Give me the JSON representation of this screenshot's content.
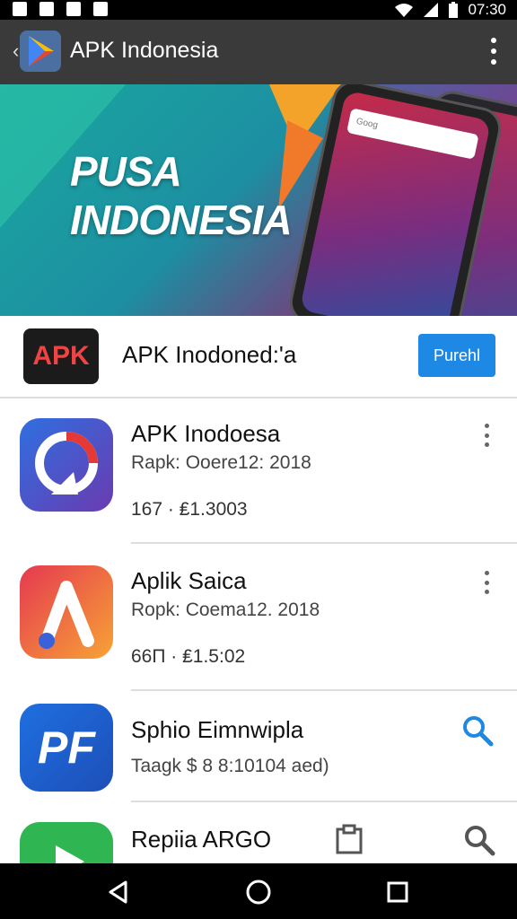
{
  "status_bar": {
    "time": "07:30"
  },
  "app_bar": {
    "title": "APK Indonesia"
  },
  "banner": {
    "line1": "PUSA",
    "line2": "INDONESIA",
    "phone_search": "Goog"
  },
  "featured": {
    "logo_text": "APK",
    "name": "APK Inodoned:'a",
    "button_label": "Purehl"
  },
  "apps": [
    {
      "name": "APK Inodoesa",
      "subtitle": "Rapk: Ooere12: 2018",
      "meta": "167 · ₤1.3003"
    },
    {
      "name": "Aplik Saica",
      "subtitle": "Ropk: Coema12. 2018",
      "meta": "66П · ₤1.5:02"
    },
    {
      "name": "Sphio Eimnwipla",
      "subtitle": "Taagk $ 8 8:10104 aed)",
      "icon_text": "PF"
    },
    {
      "name": "Repiia ARGO"
    }
  ],
  "colors": {
    "install_button": "#1e88e5",
    "search_icon": "#1e88e5"
  },
  "icons": [
    "image-icon",
    "signal-icon",
    "battery-icon",
    "wifi-icon",
    "back-icon",
    "more-icon",
    "search-icon",
    "clipboard-icon",
    "nav-back-icon",
    "nav-home-icon",
    "nav-recents-icon"
  ]
}
